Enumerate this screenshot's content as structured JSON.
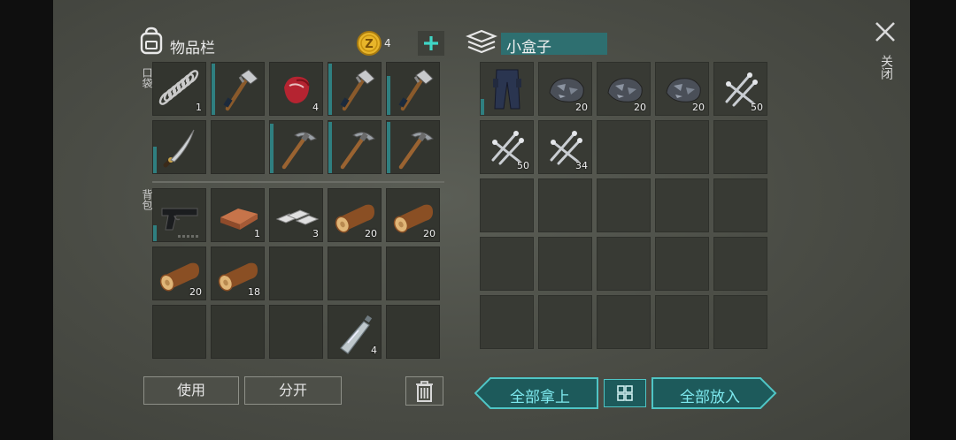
{
  "inventory": {
    "title": "物品栏",
    "coins": "4",
    "pocket_label": "口袋",
    "backpack_label": "背包",
    "pocket_slots": [
      {
        "icon": "spring-icon",
        "qty": "1"
      },
      {
        "icon": "hatchet-icon",
        "qty": ""
      },
      {
        "icon": "raw-meat-icon",
        "qty": "4"
      },
      {
        "icon": "hatchet-icon",
        "qty": ""
      },
      {
        "icon": "hatchet-icon",
        "qty": ""
      },
      {
        "icon": "machete-icon",
        "qty": ""
      },
      {
        "icon": "",
        "qty": ""
      },
      {
        "icon": "pickaxe-icon",
        "qty": ""
      },
      {
        "icon": "pickaxe-icon",
        "qty": ""
      },
      {
        "icon": "pickaxe-icon",
        "qty": ""
      }
    ],
    "backpack_slots": [
      {
        "icon": "pistol-icon",
        "qty": ""
      },
      {
        "icon": "copper-ingot-icon",
        "qty": "1"
      },
      {
        "icon": "iron-bars-icon",
        "qty": "3"
      },
      {
        "icon": "log-icon",
        "qty": "20"
      },
      {
        "icon": "log-icon",
        "qty": "20"
      },
      {
        "icon": "log-icon",
        "qty": "20"
      },
      {
        "icon": "log-icon",
        "qty": "18"
      },
      {
        "icon": "",
        "qty": ""
      },
      {
        "icon": "",
        "qty": ""
      },
      {
        "icon": "",
        "qty": ""
      },
      {
        "icon": "",
        "qty": ""
      },
      {
        "icon": "",
        "qty": ""
      },
      {
        "icon": "",
        "qty": ""
      },
      {
        "icon": "water-bottle-icon",
        "qty": "4"
      },
      {
        "icon": "",
        "qty": ""
      }
    ],
    "use_label": "使用",
    "split_label": "分开"
  },
  "box": {
    "title": "小盒子",
    "slots": [
      {
        "icon": "pants-icon",
        "qty": ""
      },
      {
        "icon": "stone-icon",
        "qty": "20"
      },
      {
        "icon": "stone-icon",
        "qty": "20"
      },
      {
        "icon": "stone-icon",
        "qty": "20"
      },
      {
        "icon": "nails-icon",
        "qty": "50"
      },
      {
        "icon": "nails-icon",
        "qty": "50"
      },
      {
        "icon": "nails-icon",
        "qty": "34"
      }
    ],
    "take_all_label": "全部拿上",
    "put_all_label": "全部放入"
  },
  "close_label": "关闭",
  "colors": {
    "accent": "#7ee9ef",
    "teal": "#2f7f80",
    "coin": "#e8b52a"
  }
}
